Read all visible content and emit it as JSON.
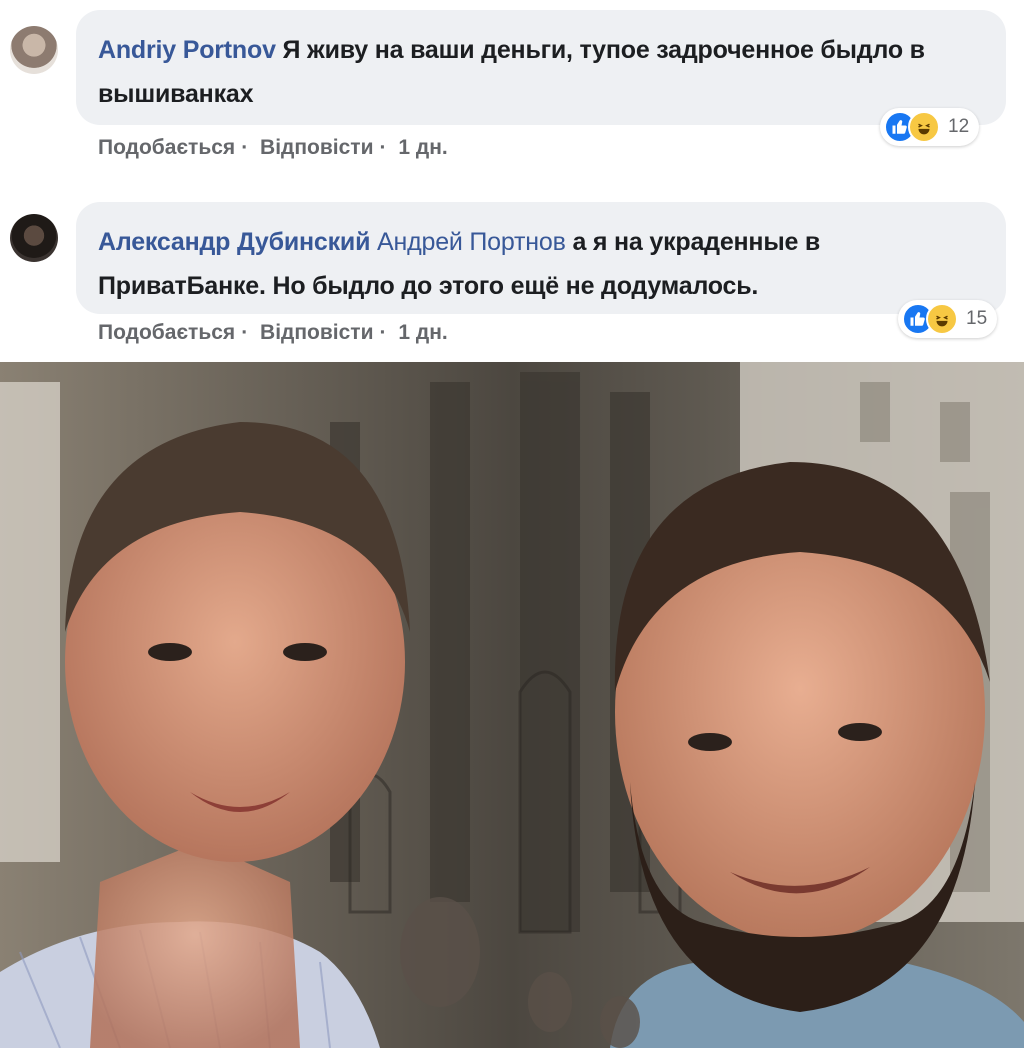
{
  "comments": [
    {
      "author": "Andriy Portnov",
      "mention": "",
      "text": "Я живу на ваши деньги, тупое задроченное быдло в вышиванках",
      "like_label": "Подобається",
      "reply_label": "Відповісти",
      "time": "1 дн.",
      "reaction_count": "12"
    },
    {
      "author": "Александр Дубинский",
      "mention": "Андрей Портнов",
      "text": "а я на украденные в ПриватБанке. Но быдло до этого ещё не додумалось.",
      "like_label": "Подобається",
      "reply_label": "Відповісти",
      "time": "1 дн.",
      "reaction_count": "15"
    }
  ],
  "colors": {
    "author": "#385898",
    "bubble": "#eef0f3",
    "like": "#1877f2",
    "haha": "#f7c843"
  },
  "icons": [
    "like-reaction-icon",
    "haha-reaction-icon"
  ]
}
